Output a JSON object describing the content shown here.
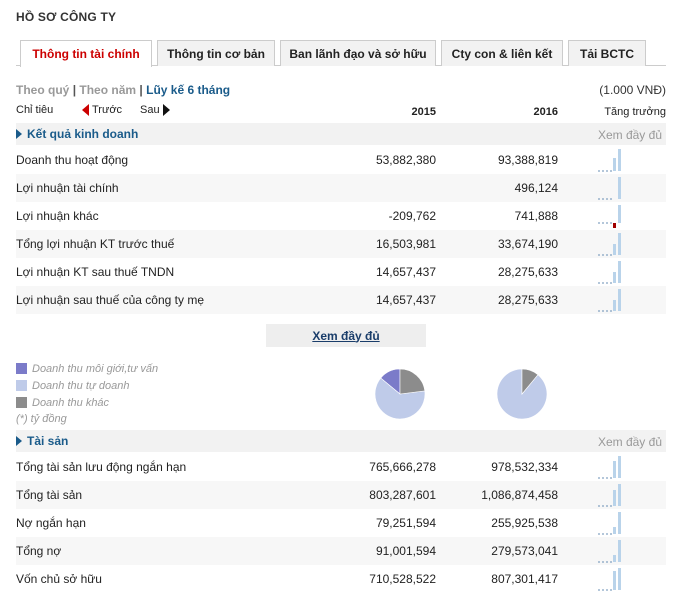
{
  "page": {
    "title": "HỒ SƠ CÔNG TY"
  },
  "tabs": [
    {
      "label": "Thông tin tài chính",
      "active": true
    },
    {
      "label": "Thông tin cơ bản",
      "active": false
    },
    {
      "label": "Ban lãnh đạo và sở hữu",
      "active": false
    },
    {
      "label": "Cty con & liên kết",
      "active": false
    },
    {
      "label": "Tải BCTC",
      "active": false
    }
  ],
  "periods": {
    "quarter": "Theo quý",
    "year": "Theo năm",
    "cumulative": "Lũy kế 6 tháng",
    "separator": "|"
  },
  "unit": "(1.000 VNĐ)",
  "header": {
    "indicator": "Chỉ tiêu",
    "prev": "Trước",
    "next": "Sau",
    "year1": "2015",
    "year2": "2016",
    "growth": "Tăng trưởng"
  },
  "colors": {
    "accent": "#1a5b8a",
    "active_tab": "#cc0000",
    "bar": "#b9d3ea",
    "bar_negative": "#a00000",
    "pie_brokerage": "#7b7bc9",
    "pie_advisory": "#bfcbe9",
    "pie_other": "#8c8c8c"
  },
  "business_results": {
    "title": "Kết quả kinh doanh",
    "more": "Xem đầy đủ",
    "rows": [
      {
        "label": "Doanh thu hoạt động",
        "v2015": "53,882,380",
        "v2016": "93,388,819"
      },
      {
        "label": "Lợi nhuận tài chính",
        "v2015": "",
        "v2016": "496,124"
      },
      {
        "label": "Lợi nhuận khác",
        "v2015": "-209,762",
        "v2016": "741,888"
      },
      {
        "label": "Tổng lợi nhuận KT trước thuế",
        "v2015": "16,503,981",
        "v2016": "33,674,190"
      },
      {
        "label": "Lợi nhuận KT sau thuế TNDN",
        "v2015": "14,657,437",
        "v2016": "28,275,633"
      },
      {
        "label": "Lợi nhuận sau thuế của công ty mẹ",
        "v2015": "14,657,437",
        "v2016": "28,275,633"
      }
    ]
  },
  "more_button": "Xem đầy đủ",
  "legend": {
    "items": [
      {
        "label": "Doanh thu môi giới,tư vấn",
        "color": "#7b7bc9"
      },
      {
        "label": "Doanh thu tự doanh",
        "color": "#bfcbe9"
      },
      {
        "label": "Doanh thu khác",
        "color": "#8c8c8c"
      }
    ],
    "note": "(*) tỷ đồng"
  },
  "chart_data": [
    {
      "type": "pie",
      "categories": [
        "Doanh thu môi giới,tư vấn",
        "Doanh thu tự doanh",
        "Doanh thu khác"
      ],
      "values": [
        14,
        63,
        23
      ],
      "title": ""
    },
    {
      "type": "pie",
      "categories": [
        "Doanh thu môi giới,tư vấn",
        "Doanh thu tự doanh",
        "Doanh thu khác"
      ],
      "values": [
        0,
        89,
        11
      ],
      "title": ""
    }
  ],
  "assets": {
    "title": "Tài sản",
    "more": "Xem đầy đủ",
    "rows": [
      {
        "label": "Tổng tài sản lưu động ngắn hạn",
        "v2015": "765,666,278",
        "v2016": "978,532,334"
      },
      {
        "label": "Tổng tài sản",
        "v2015": "803,287,601",
        "v2016": "1,086,874,458"
      },
      {
        "label": "Nợ ngắn hạn",
        "v2015": "79,251,594",
        "v2016": "255,925,538"
      },
      {
        "label": "Tổng nợ",
        "v2015": "91,001,594",
        "v2016": "279,573,041"
      },
      {
        "label": "Vốn chủ sở hữu",
        "v2015": "710,528,522",
        "v2016": "807,301,417"
      }
    ]
  }
}
